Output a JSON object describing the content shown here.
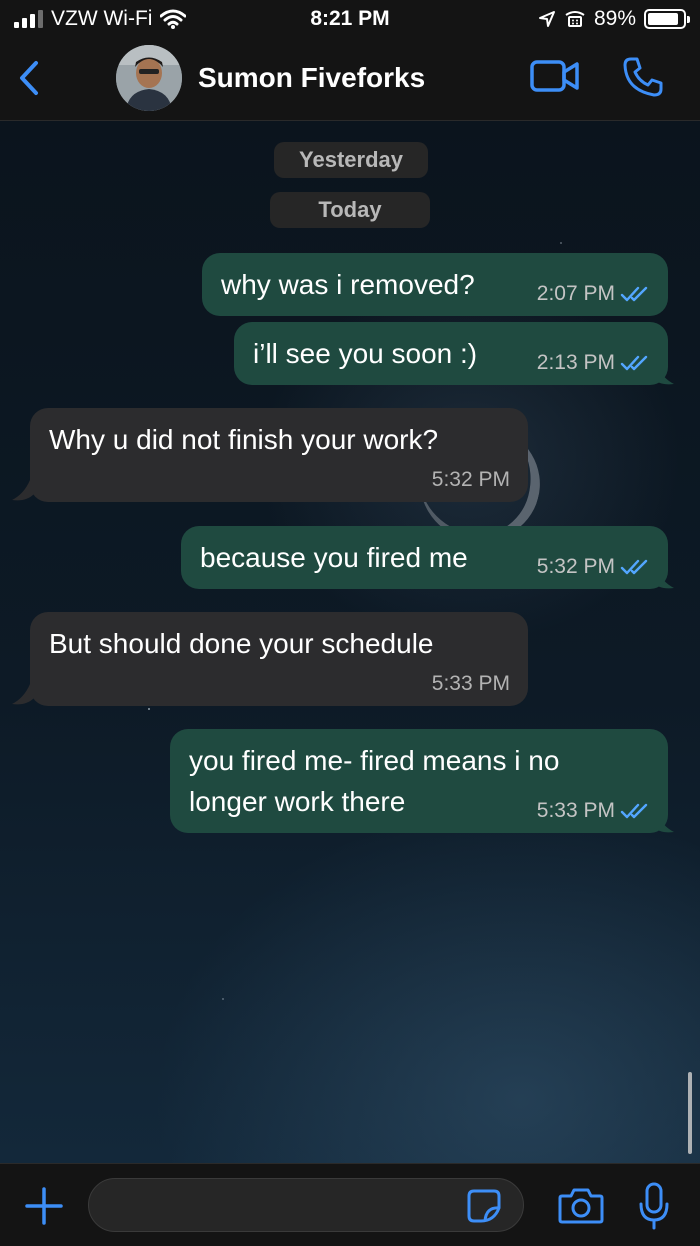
{
  "status_bar": {
    "carrier": "VZW Wi-Fi",
    "time": "8:21 PM",
    "battery": "89%",
    "battery_level": 0.89
  },
  "header": {
    "contact_name": "Sumon Fiveforks"
  },
  "date_chips": [
    "Yesterday",
    "Today"
  ],
  "messages": [
    {
      "direction": "outgoing",
      "text": "why was i removed?",
      "time": "2:07 PM",
      "read": true
    },
    {
      "direction": "outgoing",
      "text": "i’ll see you soon :)",
      "time": "2:13 PM",
      "read": true
    },
    {
      "direction": "incoming",
      "text": "Why u did not finish your work?",
      "time": "5:32 PM"
    },
    {
      "direction": "outgoing",
      "text": "because you fired me",
      "time": "5:32 PM",
      "read": true
    },
    {
      "direction": "incoming",
      "text": "But should done your schedule",
      "time": "5:33 PM"
    },
    {
      "direction": "outgoing",
      "text_lines": [
        "you fired me- fired means i no",
        "longer work there"
      ],
      "time": "5:33 PM",
      "read": true
    }
  ],
  "composer": {
    "value": "",
    "placeholder": ""
  },
  "colors": {
    "accent": "#3d8ef7",
    "outgoing_bubble": "#1f4a40",
    "incoming_bubble": "#2c2c2e",
    "read_ticks": "#53a6ff"
  }
}
